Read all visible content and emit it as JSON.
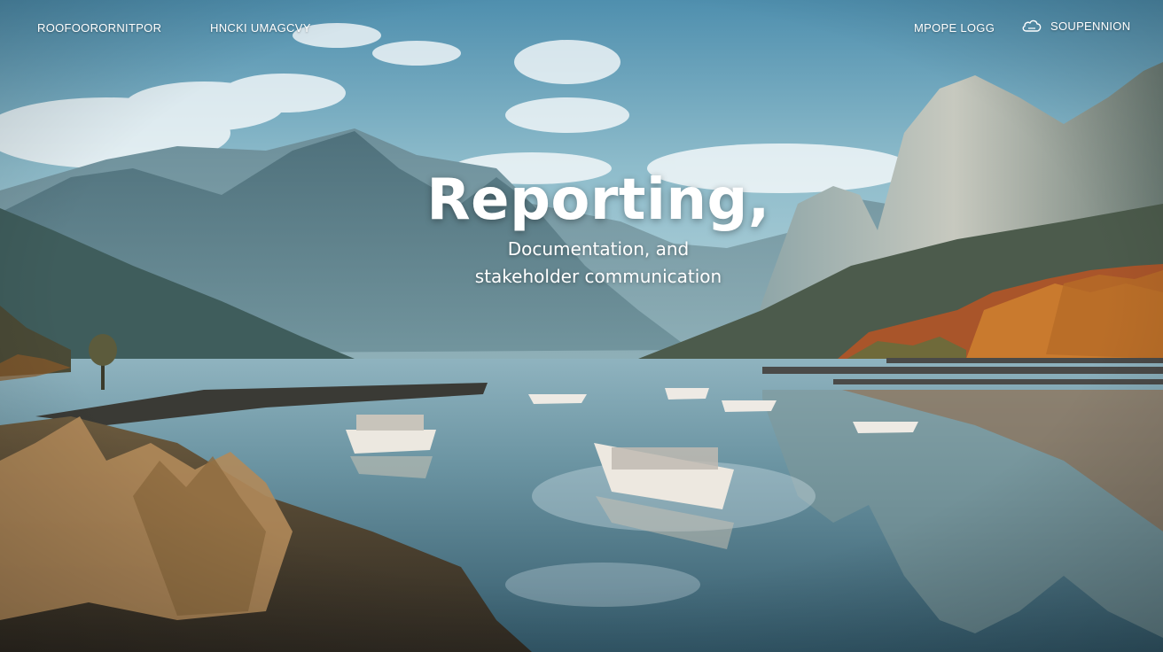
{
  "nav": {
    "brand": "ROOFOORORNITPOR",
    "link_1": "HNCKI UMAGCVY",
    "blog": "MPOPE LOGG",
    "support": "SOUPENNION",
    "support_icon": "cloud-icon"
  },
  "hero": {
    "title": "Reporting,",
    "subtitle_line1": "Documentation, and",
    "subtitle_line2": "stakeholder communication"
  },
  "background": {
    "scene": "mountain lake with boats and autumn trees",
    "sky_color": "#6fa6bd",
    "water_color": "#5d8797",
    "mountain_color": "#5f7f8a",
    "foliage_color": "#c6692b"
  }
}
